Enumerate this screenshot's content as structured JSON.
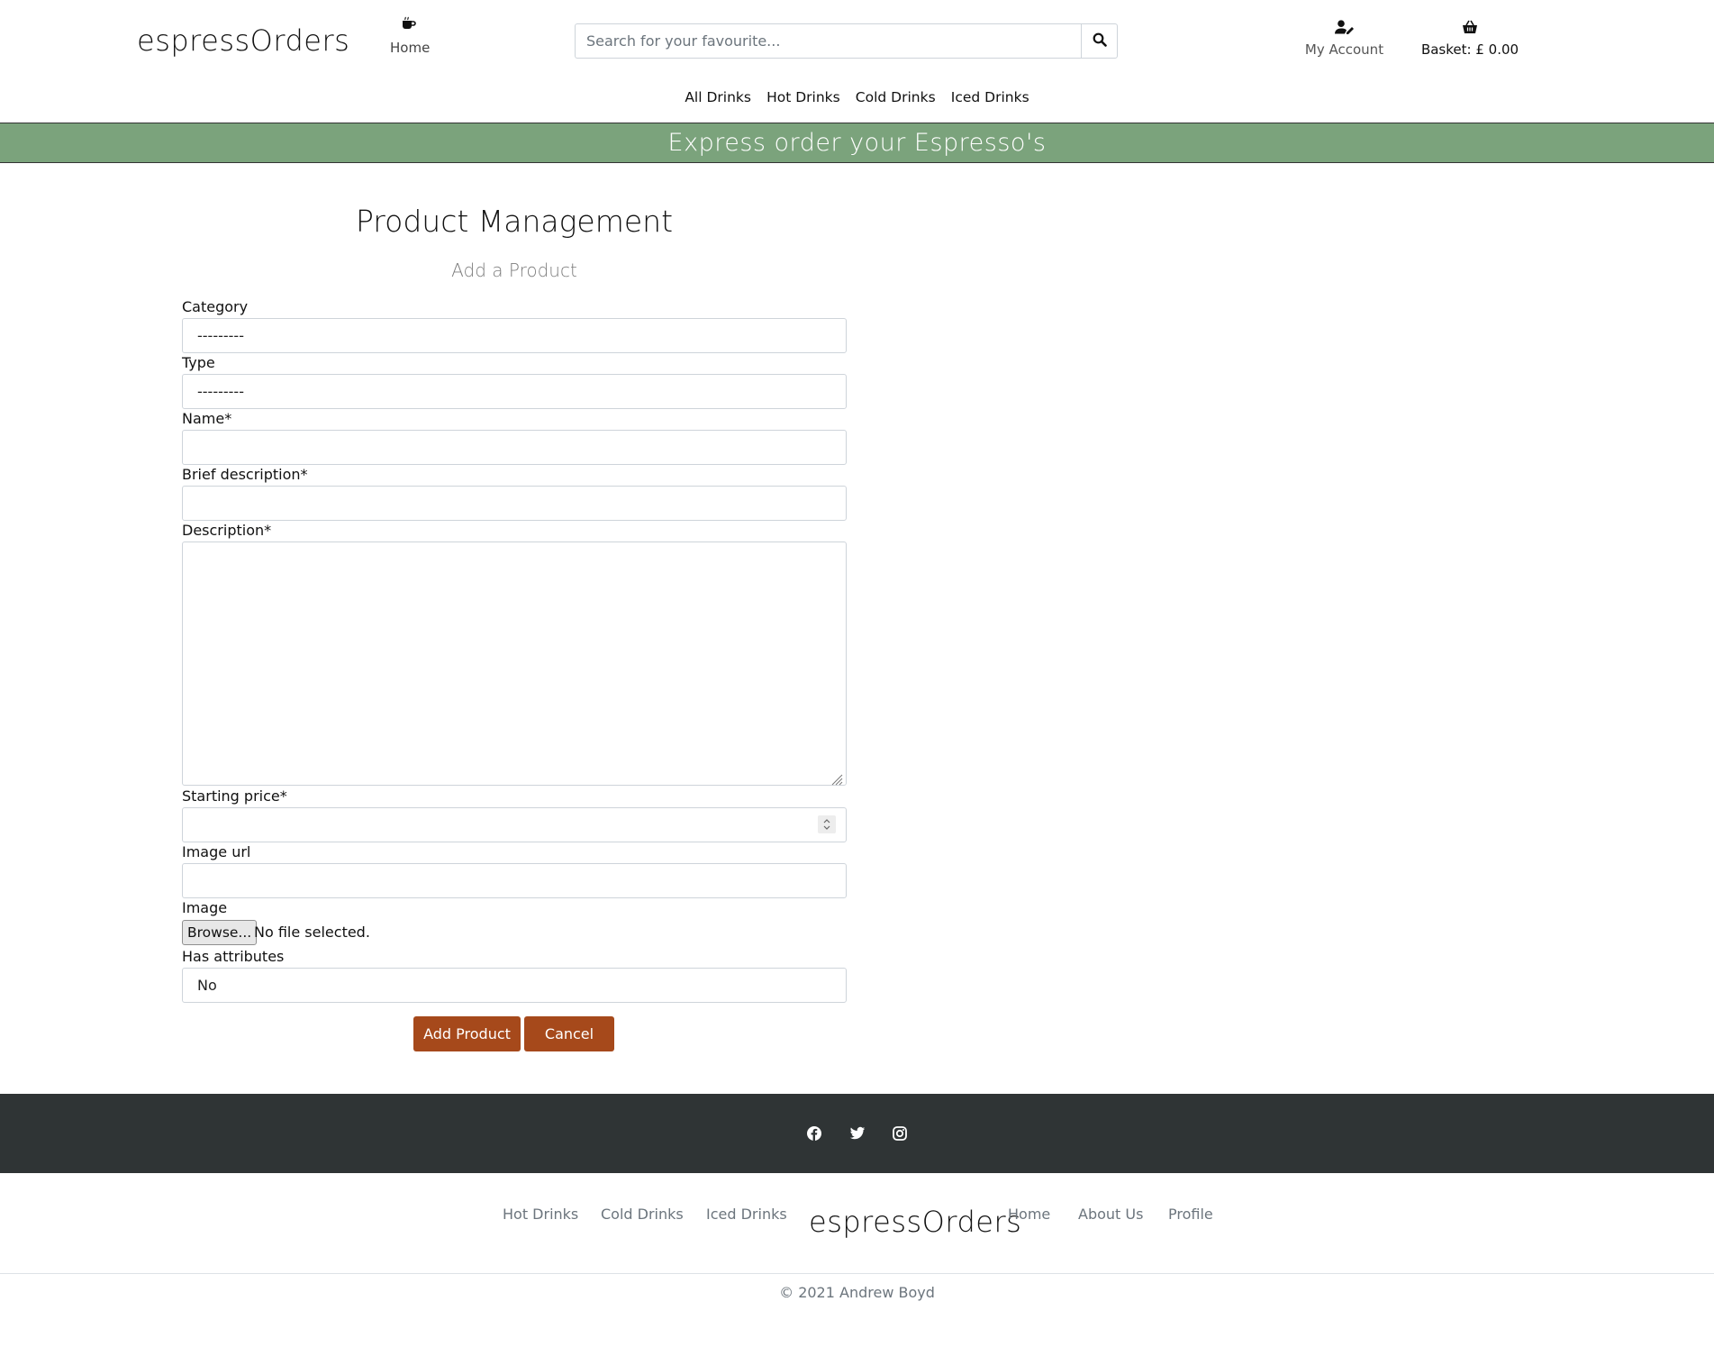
{
  "header": {
    "brand": "espressOrders",
    "home_label": "Home",
    "search_placeholder": "Search for your favourite...",
    "account_label": "My Account",
    "basket_label": "Basket: £ 0.00"
  },
  "nav": [
    "All Drinks",
    "Hot Drinks",
    "Cold Drinks",
    "Iced Drinks"
  ],
  "banner": "Express order your Espresso's",
  "form": {
    "title": "Product Management",
    "subtitle": "Add a Product",
    "category_label": "Category",
    "category_value": "---------",
    "type_label": "Type",
    "type_value": "---------",
    "name_label": "Name*",
    "brief_label": "Brief description*",
    "description_label": "Description*",
    "price_label": "Starting price*",
    "image_url_label": "Image url",
    "image_label": "Image",
    "browse_label": "Browse...",
    "file_status": "No file selected.",
    "attributes_label": "Has attributes",
    "attributes_value": "No",
    "add_button": "Add Product",
    "cancel_button": "Cancel"
  },
  "footer": {
    "social_icons": [
      "facebook-icon",
      "twitter-icon",
      "instagram-icon"
    ],
    "links_left": [
      "Hot Drinks",
      "Cold Drinks",
      "Iced Drinks"
    ],
    "brand": "espressOrders",
    "links_right": [
      "Home",
      "About Us",
      "Profile"
    ],
    "copyright": "© 2021 Andrew Boyd"
  },
  "colors": {
    "banner": "#7ba37c",
    "button": "#a6491b",
    "footer_dark": "#2f3435"
  }
}
